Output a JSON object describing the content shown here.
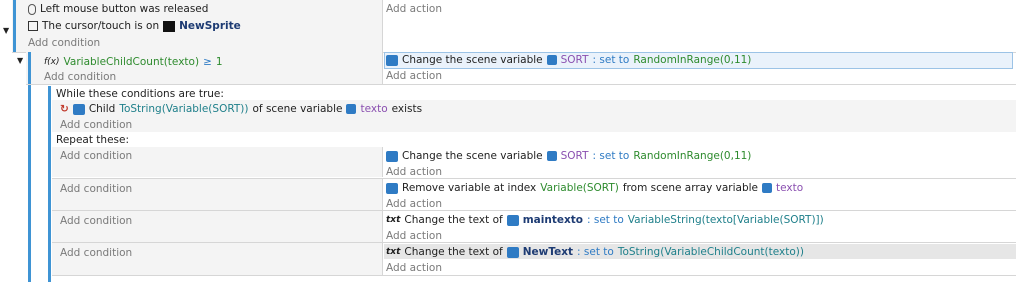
{
  "event1": {
    "cond1": "Left mouse button was released",
    "cond2_prefix": "The cursor/touch is on",
    "cond2_object": "NewSprite",
    "add_condition": "Add condition",
    "add_action": "Add action"
  },
  "event2": {
    "fx_label": "f(x)",
    "cond_expr": "VariableChildCount(texto)",
    "cond_op": "≥",
    "cond_val": "1",
    "add_condition": "Add condition",
    "action_prefix": "Change the scene variable",
    "action_var": "SORT",
    "action_setto": ": set to",
    "action_value": "RandomInRange(0,11)",
    "add_action": "Add action"
  },
  "while": {
    "header": "While these conditions are true:",
    "cond_prefix": "Child",
    "cond_expr": "ToString(Variable(SORT))",
    "cond_middle": "of scene variable",
    "cond_var": "texto",
    "cond_suffix": "exists",
    "add_condition": "Add condition",
    "repeat_header": "Repeat these:"
  },
  "sub1": {
    "add_condition": "Add condition",
    "action_prefix": "Change the scene variable",
    "action_var": "SORT",
    "action_setto": ": set to",
    "action_value": "RandomInRange(0,11)",
    "add_action": "Add action"
  },
  "sub2": {
    "add_condition": "Add condition",
    "action_prefix": "Remove variable at index",
    "action_index": "Variable(SORT)",
    "action_middle": "from scene array variable",
    "action_var": "texto",
    "add_action": "Add action"
  },
  "sub3": {
    "add_condition": "Add condition",
    "text_icon": "txt",
    "action_prefix": "Change the text of",
    "action_object": "maintexto",
    "action_setto": ": set to",
    "action_value": "VariableString(texto[Variable(SORT)])",
    "add_action": "Add action"
  },
  "sub4": {
    "add_condition": "Add condition",
    "text_icon": "txt",
    "action_prefix": "Change the text of",
    "action_object": "NewText",
    "action_setto": ": set to",
    "action_value": "ToString(VariableChildCount(texto))",
    "add_action": "Add action"
  },
  "colors": {
    "accent_bar": "#3f94d4",
    "string_green": "#2e8b2e",
    "variable_purple": "#8a4fb0",
    "setto_blue": "#2f7bc4"
  }
}
